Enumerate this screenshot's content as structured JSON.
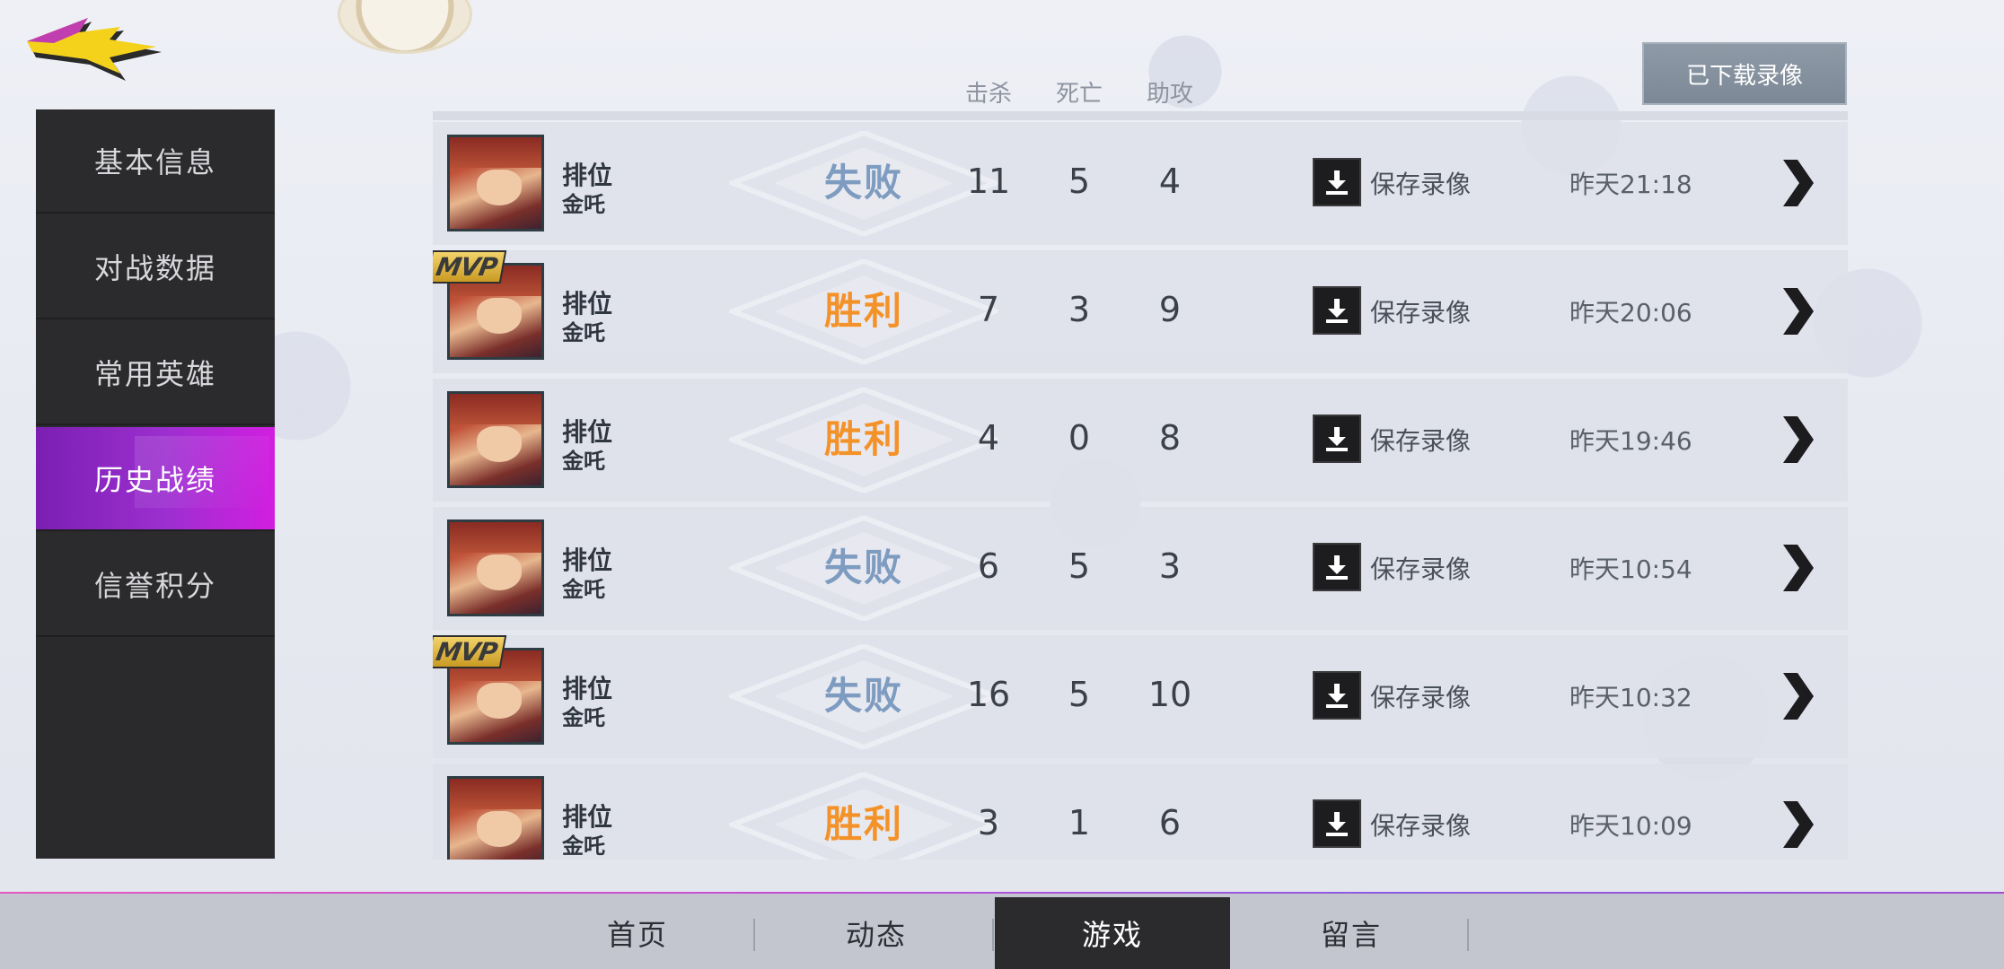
{
  "sidebar": {
    "items": [
      {
        "label": "基本信息",
        "active": false
      },
      {
        "label": "对战数据",
        "active": false
      },
      {
        "label": "常用英雄",
        "active": false
      },
      {
        "label": "历史战绩",
        "active": true
      },
      {
        "label": "信誉积分",
        "active": false
      }
    ]
  },
  "header": {
    "col_kills": "击杀",
    "col_deaths": "死亡",
    "col_assists": "助攻",
    "downloaded_button": "已下载录像"
  },
  "matches": [
    {
      "mode": "排位",
      "hero": "金吒",
      "result": "失败",
      "win": false,
      "mvp": false,
      "kills": "11",
      "deaths": "5",
      "assists": "4",
      "save_label": "保存录像",
      "time": "昨天21:18"
    },
    {
      "mode": "排位",
      "hero": "金吒",
      "result": "胜利",
      "win": true,
      "mvp": true,
      "mvp_label": "MVP",
      "kills": "7",
      "deaths": "3",
      "assists": "9",
      "save_label": "保存录像",
      "time": "昨天20:06"
    },
    {
      "mode": "排位",
      "hero": "金吒",
      "result": "胜利",
      "win": true,
      "mvp": false,
      "kills": "4",
      "deaths": "0",
      "assists": "8",
      "save_label": "保存录像",
      "time": "昨天19:46"
    },
    {
      "mode": "排位",
      "hero": "金吒",
      "result": "失败",
      "win": false,
      "mvp": false,
      "kills": "6",
      "deaths": "5",
      "assists": "3",
      "save_label": "保存录像",
      "time": "昨天10:54"
    },
    {
      "mode": "排位",
      "hero": "金吒",
      "result": "失败",
      "win": false,
      "mvp": true,
      "mvp_label": "MVP",
      "kills": "16",
      "deaths": "5",
      "assists": "10",
      "save_label": "保存录像",
      "time": "昨天10:32"
    },
    {
      "mode": "排位",
      "hero": "金吒",
      "result": "胜利",
      "win": true,
      "mvp": false,
      "kills": "3",
      "deaths": "1",
      "assists": "6",
      "save_label": "保存录像",
      "time": "昨天10:09"
    }
  ],
  "bottom_nav": [
    {
      "label": "首页",
      "active": false
    },
    {
      "label": "动态",
      "active": false
    },
    {
      "label": "游戏",
      "active": true
    },
    {
      "label": "留言",
      "active": false
    }
  ],
  "colors": {
    "win": "#f4922a",
    "lose": "#7e9bc0",
    "active_tab": "#9d2fd0"
  }
}
